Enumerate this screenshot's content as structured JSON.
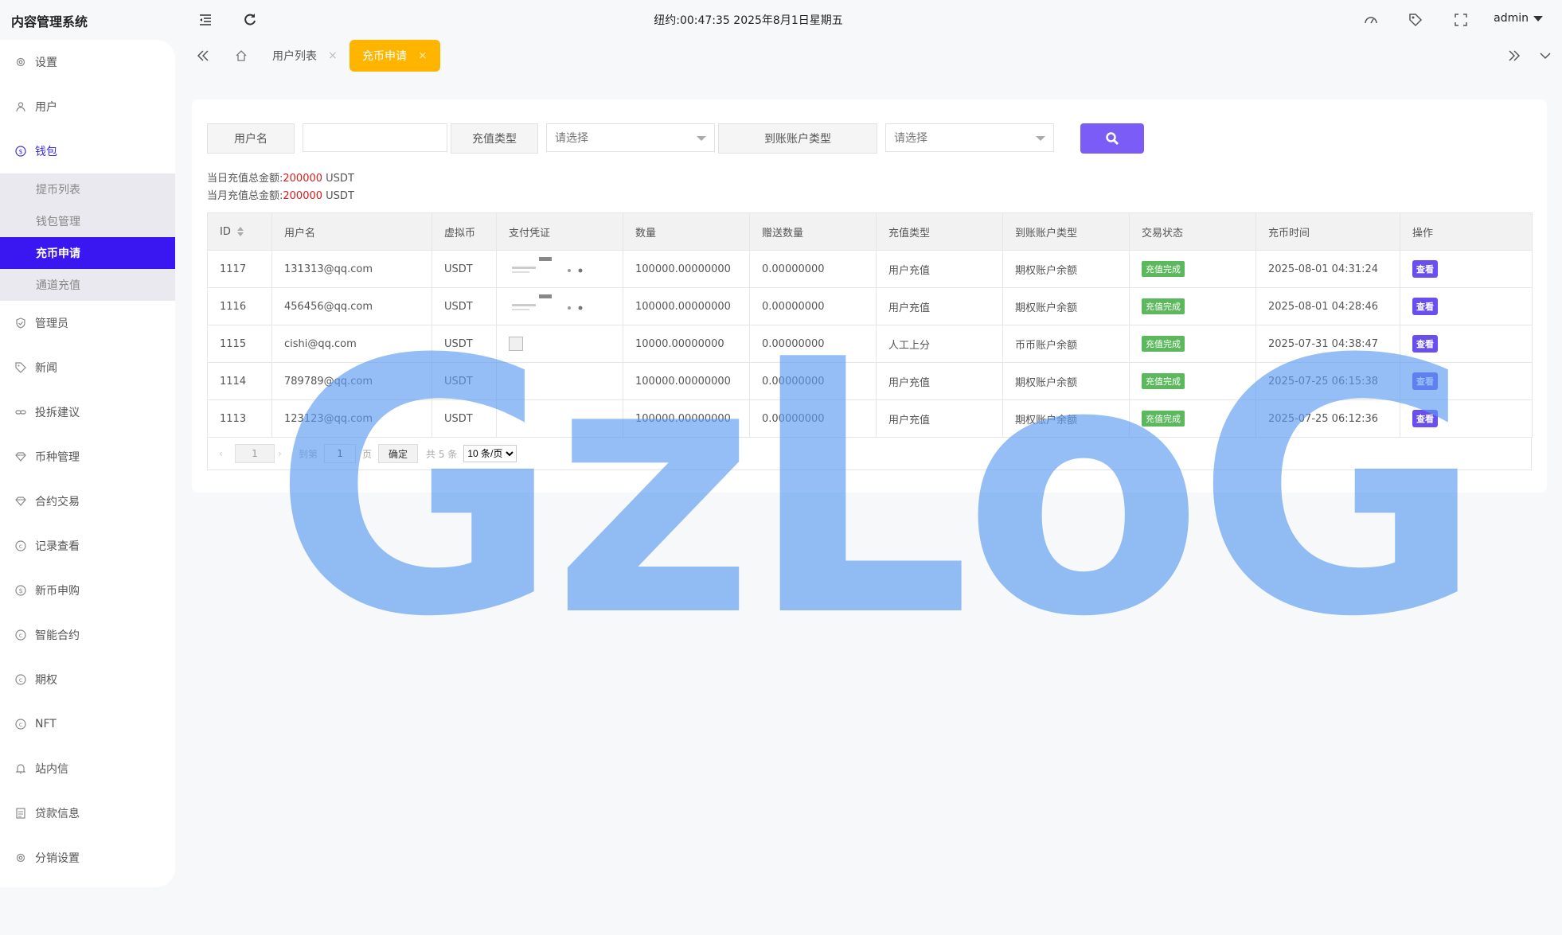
{
  "header": {
    "app_title": "内容管理系统",
    "clock": "纽约:00:47:35 2025年8月1日星期五",
    "user": "admin"
  },
  "sidebar": {
    "items": [
      {
        "label": "设置",
        "icon": "gear-icon"
      },
      {
        "label": "用户",
        "icon": "user-icon"
      },
      {
        "label": "钱包",
        "icon": "dollar-circle-icon"
      },
      {
        "label": "管理员",
        "icon": "shield-check-icon"
      },
      {
        "label": "新闻",
        "icon": "tag-icon"
      },
      {
        "label": "投拆建议",
        "icon": "link-icon"
      },
      {
        "label": "币种管理",
        "icon": "diamond-icon"
      },
      {
        "label": "合约交易",
        "icon": "diamond-icon"
      },
      {
        "label": "记录查看",
        "icon": "coin-icon"
      },
      {
        "label": "新币申购",
        "icon": "dollar-circle-icon"
      },
      {
        "label": "智能合约",
        "icon": "coin-icon"
      },
      {
        "label": "期权",
        "icon": "coin-icon"
      },
      {
        "label": "NFT",
        "icon": "coin-icon"
      },
      {
        "label": "站内信",
        "icon": "bell-icon"
      },
      {
        "label": "贷款信息",
        "icon": "document-icon"
      },
      {
        "label": "分销设置",
        "icon": "gear-icon"
      }
    ],
    "wallet_sub": [
      {
        "label": "提币列表"
      },
      {
        "label": "钱包管理"
      },
      {
        "label": "充币申请"
      },
      {
        "label": "通道充值"
      }
    ]
  },
  "tabs": {
    "items": [
      {
        "label": "用户列表",
        "close": "×"
      },
      {
        "label": "充币申请",
        "close": "×"
      }
    ]
  },
  "filters": {
    "username_label": "用户名",
    "username_value": "",
    "type_label": "充值类型",
    "type_select": "请选择",
    "account_label": "到账账户类型",
    "account_select": "请选择"
  },
  "totals": {
    "daily_label": "当日充值总金额:",
    "daily_amount": "200000",
    "daily_unit": " USDT",
    "monthly_label": "当月充值总金额:",
    "monthly_amount": "200000",
    "monthly_unit": " USDT"
  },
  "table": {
    "headers": [
      "ID",
      "用户名",
      "虚拟币",
      "支付凭证",
      "数量",
      "赠送数量",
      "充值类型",
      "到账账户类型",
      "交易状态",
      "充币时间",
      "操作"
    ],
    "rows": [
      {
        "id": "1117",
        "user": "131313@qq.com",
        "coin": "USDT",
        "qty": "100000.00000000",
        "gift": "0.00000000",
        "type": "用户充值",
        "account": "期权账户余额",
        "status": "充值完成",
        "time": "2025-08-01 04:31:24",
        "action": "查看"
      },
      {
        "id": "1116",
        "user": "456456@qq.com",
        "coin": "USDT",
        "qty": "100000.00000000",
        "gift": "0.00000000",
        "type": "用户充值",
        "account": "期权账户余额",
        "status": "充值完成",
        "time": "2025-08-01 04:28:46",
        "action": "查看"
      },
      {
        "id": "1115",
        "user": "cishi@qq.com",
        "coin": "USDT",
        "qty": "10000.00000000",
        "gift": "0.00000000",
        "type": "人工上分",
        "account": "币币账户余额",
        "status": "充值完成",
        "time": "2025-07-31 04:38:47",
        "action": "查看"
      },
      {
        "id": "1114",
        "user": "789789@qq.com",
        "coin": "USDT",
        "qty": "100000.00000000",
        "gift": "0.00000000",
        "type": "用户充值",
        "account": "期权账户余额",
        "status": "充值完成",
        "time": "2025-07-25 06:15:38",
        "action": "查看"
      },
      {
        "id": "1113",
        "user": "123123@qq.com",
        "coin": "USDT",
        "qty": "100000.00000000",
        "gift": "0.00000000",
        "type": "用户充值",
        "account": "期权账户余额",
        "status": "充值完成",
        "time": "2025-07-25 06:12:36",
        "action": "查看"
      }
    ]
  },
  "pager": {
    "current": "1",
    "goto_label": "到第",
    "goto_value": "1",
    "page_unit": "页",
    "confirm": "确定",
    "total": "共 5 条",
    "per_page": "10 条/页"
  },
  "watermark": "GzLoG",
  "colors": {
    "accent": "#3a17f0",
    "active_tab": "#ffb400",
    "search_button": "#7c5cf6",
    "status_badge": "#5cb85c",
    "amount": "#d61d1d"
  }
}
